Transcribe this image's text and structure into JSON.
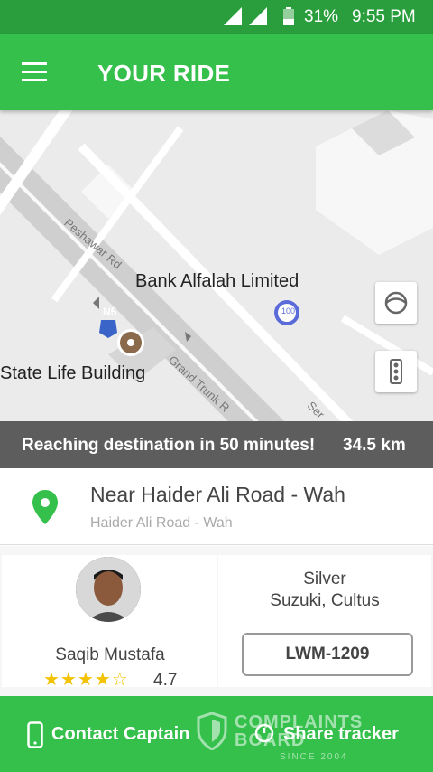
{
  "status_bar": {
    "battery": "31%",
    "time": "9:55 PM"
  },
  "app_bar": {
    "title": "YOUR RIDE"
  },
  "map": {
    "poi_1": "Bank Alfalah Limited",
    "poi_2": "State Life Building",
    "road_1": "Peshawar Rd",
    "road_2": "Grand Trunk R",
    "road_3": "Ser",
    "highway_shield": "N5",
    "poi_badge": "100"
  },
  "eta": {
    "message": "Reaching destination in 50 minutes!",
    "distance": "34.5 km"
  },
  "destination": {
    "title": "Near Haider Ali Road - Wah",
    "subtitle": "Haider Ali Road - Wah"
  },
  "captain": {
    "name": "Saqib Mustafa",
    "rating": "4.7",
    "stars": "★★★★☆"
  },
  "vehicle": {
    "color": "Silver",
    "model": "Suzuki, Cultus",
    "plate": "LWM-1209"
  },
  "actions": {
    "contact_label": "Contact Captain",
    "share_label": "Share tracker"
  },
  "watermark": {
    "line1": "COMPLAINTS",
    "line2": "BOARD",
    "line3": "SINCE 2004"
  },
  "colors": {
    "primary": "#34c04b",
    "status": "#2a9e3c",
    "eta_bg": "#5d5d5d",
    "star": "#f3c200"
  }
}
